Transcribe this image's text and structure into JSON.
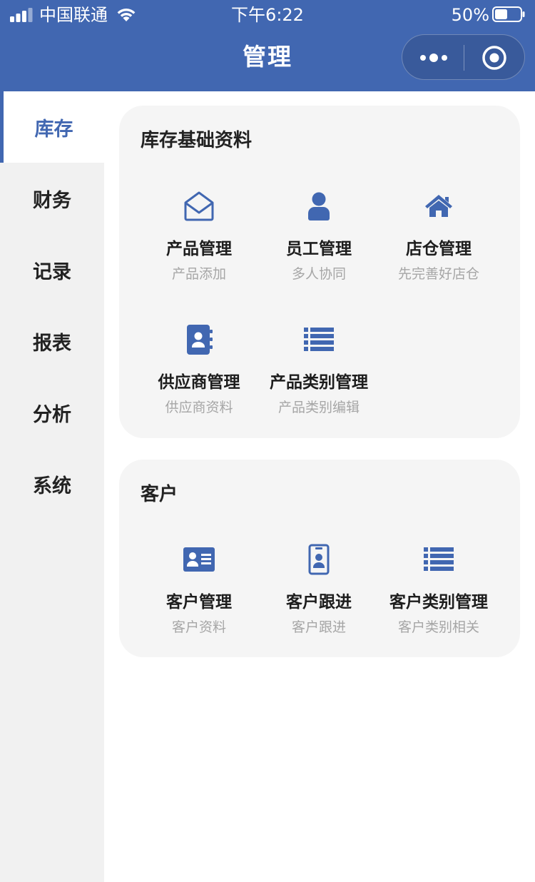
{
  "status_bar": {
    "carrier": "中国联通",
    "time": "下午6:22",
    "battery_percent": "50%",
    "battery_level": 0.5
  },
  "header": {
    "title": "管理",
    "capsule_icons": [
      "more-dots-icon",
      "target-icon"
    ]
  },
  "colors": {
    "brand": "#4167b1",
    "sidebar_bg": "#f1f1f1",
    "card_bg": "#f5f5f5",
    "subtext": "#a6a6a6"
  },
  "sidebar": {
    "items": [
      {
        "label": "库存",
        "active": true
      },
      {
        "label": "财务",
        "active": false
      },
      {
        "label": "记录",
        "active": false
      },
      {
        "label": "报表",
        "active": false
      },
      {
        "label": "分析",
        "active": false
      },
      {
        "label": "系统",
        "active": false
      }
    ]
  },
  "sections": [
    {
      "title": "库存基础资料",
      "items": [
        {
          "label": "产品管理",
          "sub": "产品添加",
          "icon": "envelope-open-icon"
        },
        {
          "label": "员工管理",
          "sub": "多人协同",
          "icon": "user-icon"
        },
        {
          "label": "店仓管理",
          "sub": "先完善好店仓",
          "icon": "home-icon"
        },
        {
          "label": "供应商管理",
          "sub": "供应商资料",
          "icon": "address-book-icon"
        },
        {
          "label": "产品类别管理",
          "sub": "产品类别编辑",
          "icon": "list-icon"
        }
      ]
    },
    {
      "title": "客户",
      "items": [
        {
          "label": "客户管理",
          "sub": "客户资料",
          "icon": "id-card-icon"
        },
        {
          "label": "客户跟进",
          "sub": "客户跟进",
          "icon": "id-badge-icon"
        },
        {
          "label": "客户类别管理",
          "sub": "客户类别相关",
          "icon": "list-icon"
        }
      ]
    }
  ]
}
